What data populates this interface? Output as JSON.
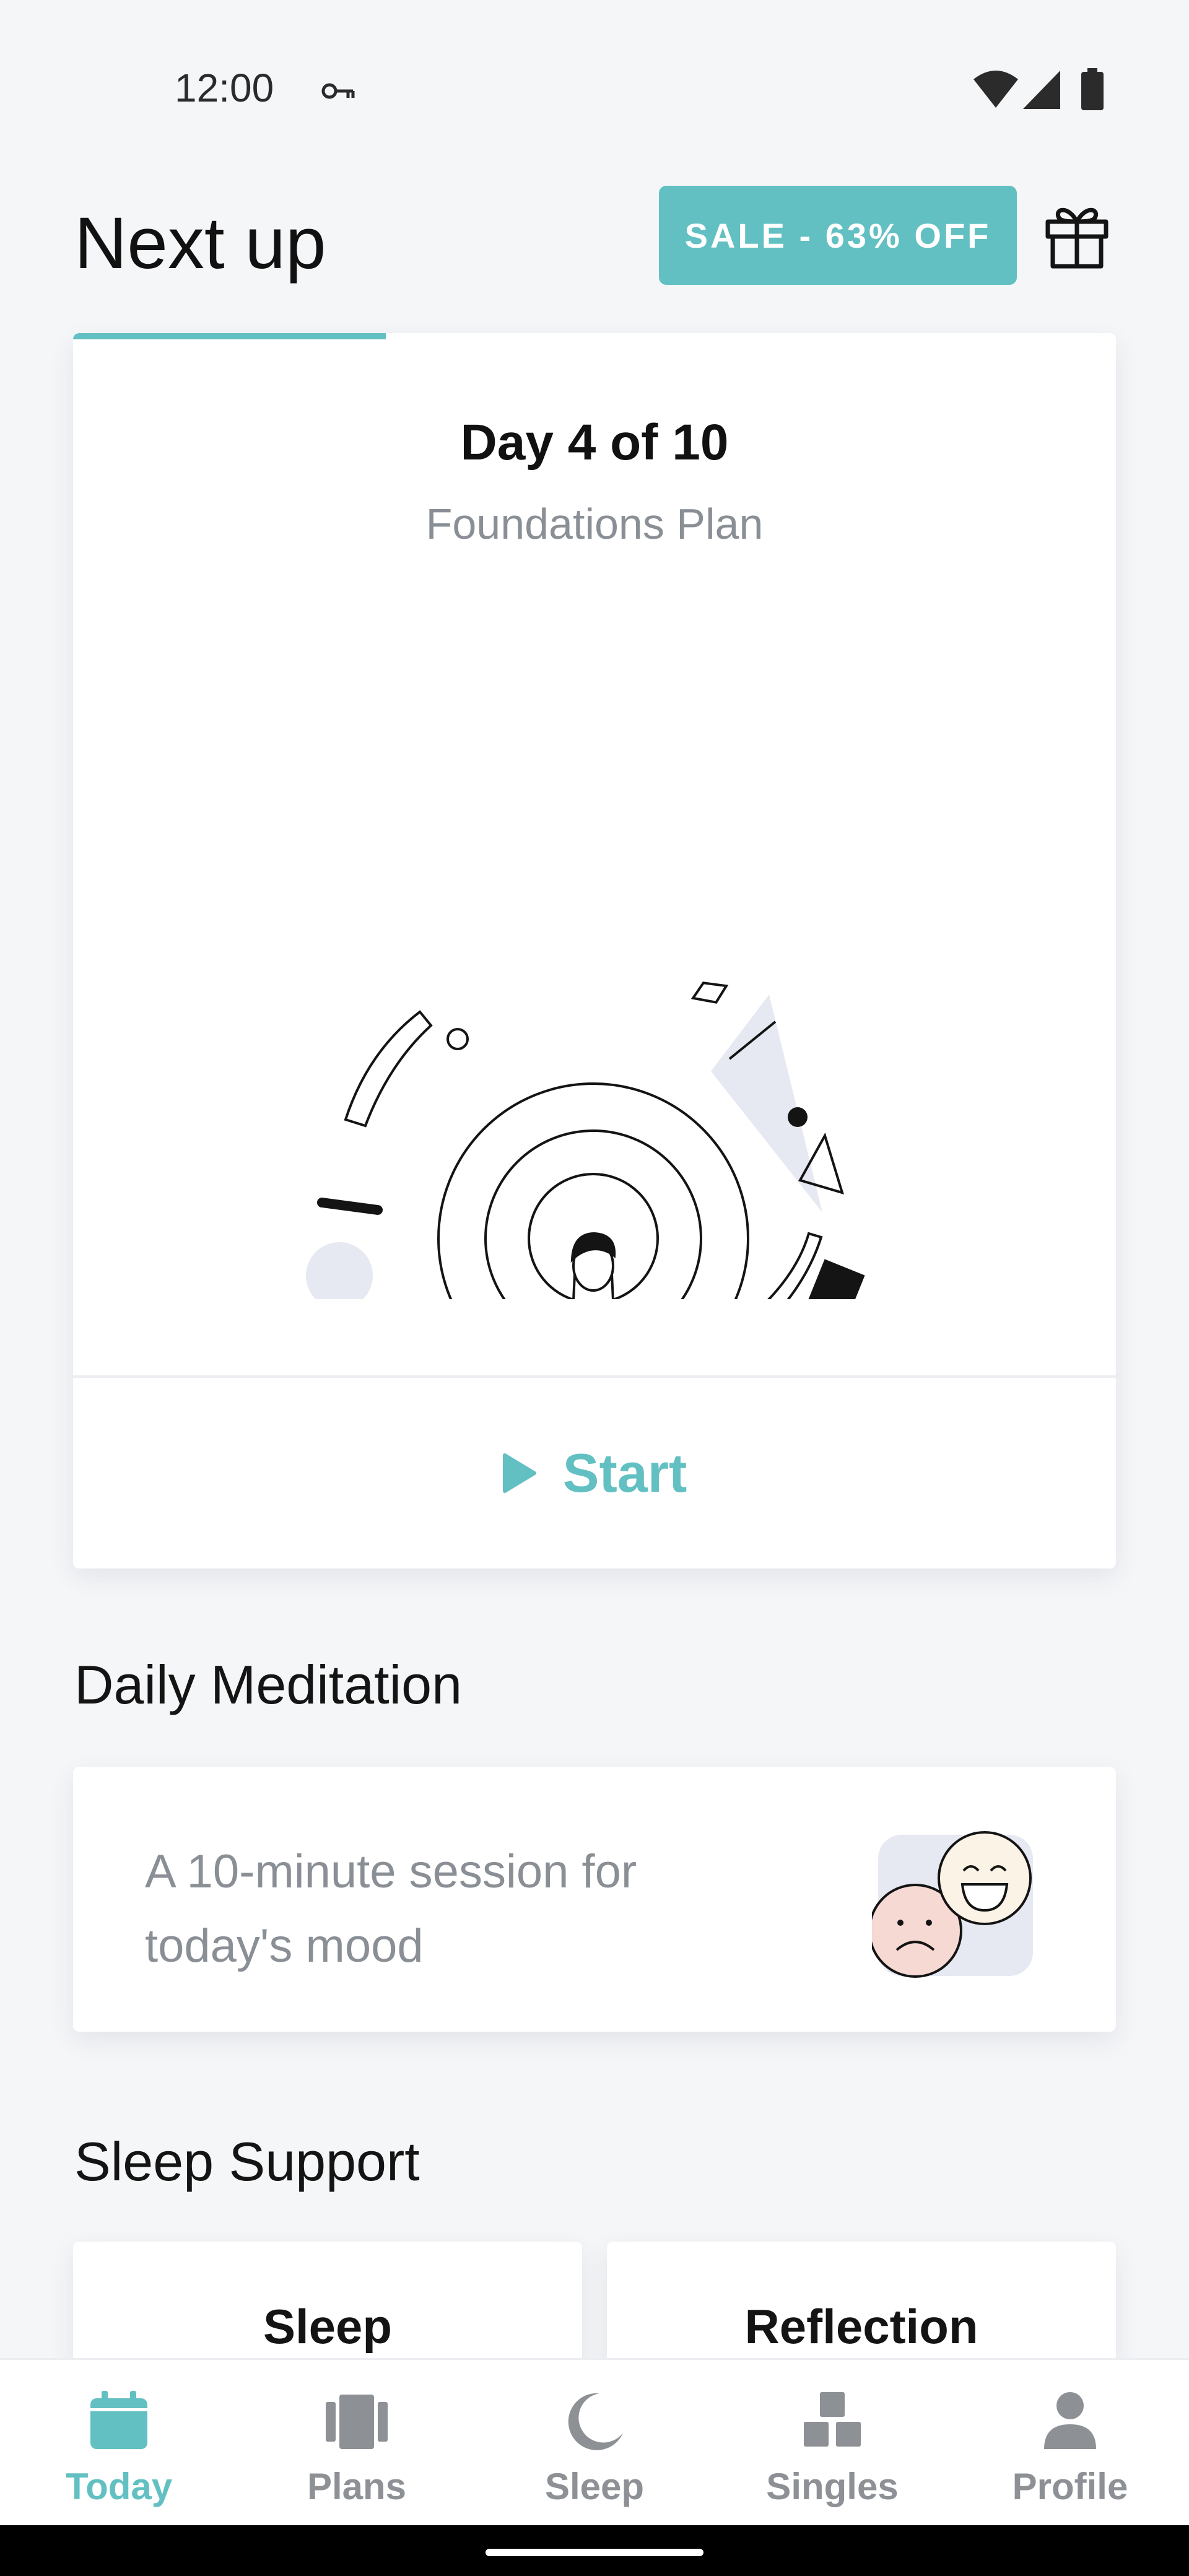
{
  "status_bar": {
    "time": "12:00"
  },
  "header": {
    "title": "Next up",
    "sale_label": "SALE - 63% OFF"
  },
  "plan_card": {
    "day": "Day 4 of 10",
    "plan_name": "Foundations Plan",
    "progress": 0.3,
    "start_label": "Start"
  },
  "daily": {
    "heading": "Daily Meditation",
    "description": "A 10-minute session for today's mood"
  },
  "sleep_support": {
    "heading": "Sleep Support",
    "cards": [
      "Sleep",
      "Reflection"
    ]
  },
  "nav": {
    "items": [
      {
        "label": "Today",
        "icon": "calendar-icon",
        "active": true
      },
      {
        "label": "Plans",
        "icon": "plans-icon",
        "active": false
      },
      {
        "label": "Sleep",
        "icon": "moon-icon",
        "active": false
      },
      {
        "label": "Singles",
        "icon": "blocks-icon",
        "active": false
      },
      {
        "label": "Profile",
        "icon": "person-icon",
        "active": false
      }
    ]
  },
  "colors": {
    "accent": "#62c0c2",
    "background": "#f5f6f8",
    "muted_text": "#8a8f96"
  }
}
